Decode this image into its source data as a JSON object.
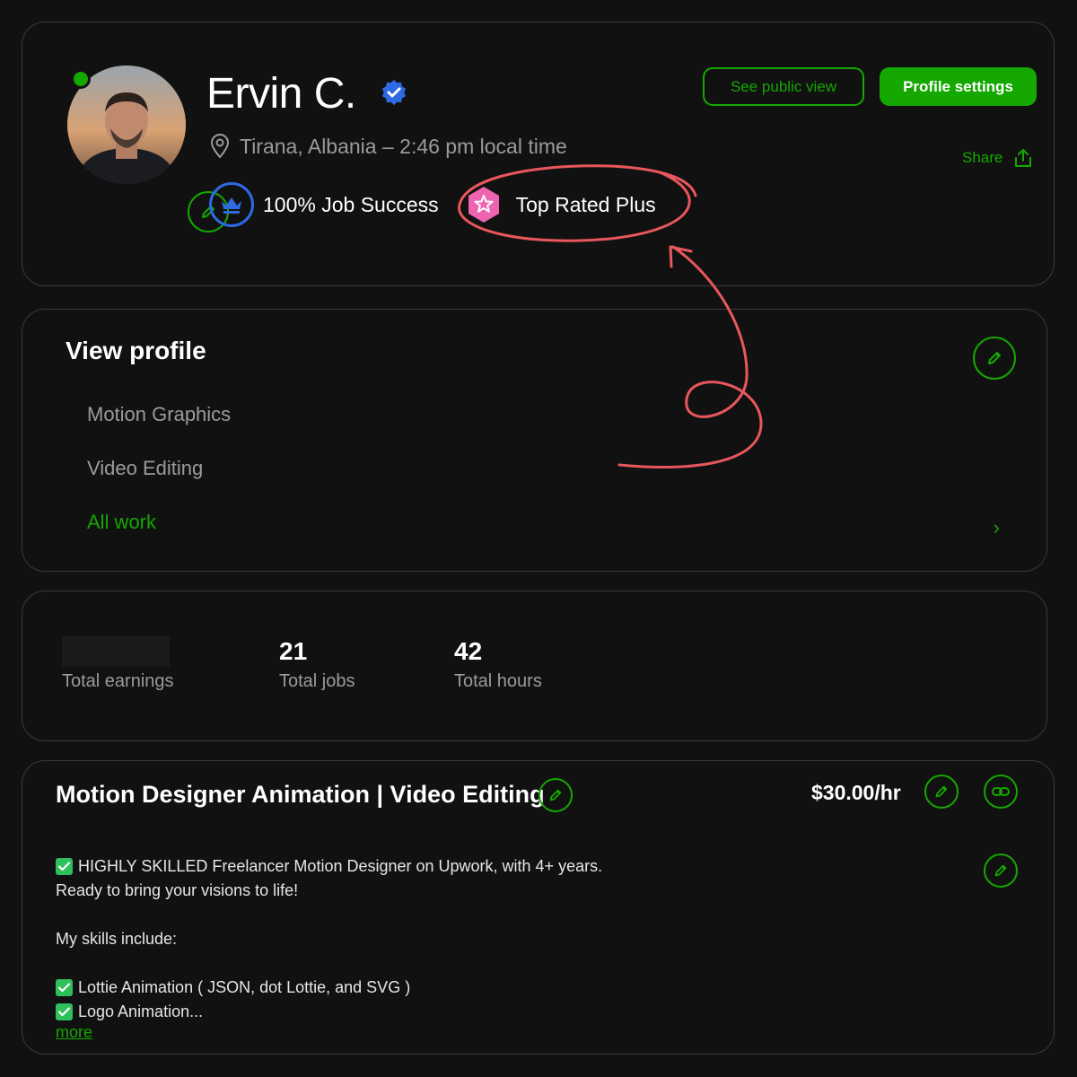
{
  "colors": {
    "accent": "#14a800",
    "background": "#111111",
    "verified": "#2d6ae3",
    "top_rated": "#ef64b0",
    "annotation": "#e8575c"
  },
  "profile": {
    "name": "Ervin C.",
    "location": "Tirana, Albania – 2:46 pm local time",
    "job_success": "100% Job Success",
    "badge": "Top Rated Plus",
    "online": true
  },
  "header": {
    "see_public_view": "See public view",
    "profile_settings": "Profile settings",
    "share": "Share"
  },
  "view_profile": {
    "title": "View profile",
    "items": [
      "Motion Graphics",
      "Video Editing"
    ],
    "all_work": "All work",
    "chevron": "›"
  },
  "stats": [
    {
      "value": "",
      "label": "Total earnings",
      "redacted": true
    },
    {
      "value": "21",
      "label": "Total jobs"
    },
    {
      "value": "42",
      "label": "Total hours"
    }
  ],
  "listing": {
    "title": "Motion Designer Animation | Video Editing",
    "rate": "$30.00/hr",
    "description": {
      "line1": "HIGHLY SKILLED Freelancer Motion Designer on Upwork, with 4+ years.",
      "line2": "Ready to bring your visions to life!",
      "line3": "My skills include:",
      "skill1": "Lottie Animation ( JSON, dot Lottie, and SVG )",
      "skill2": "Logo Animation..."
    },
    "more": "more"
  }
}
